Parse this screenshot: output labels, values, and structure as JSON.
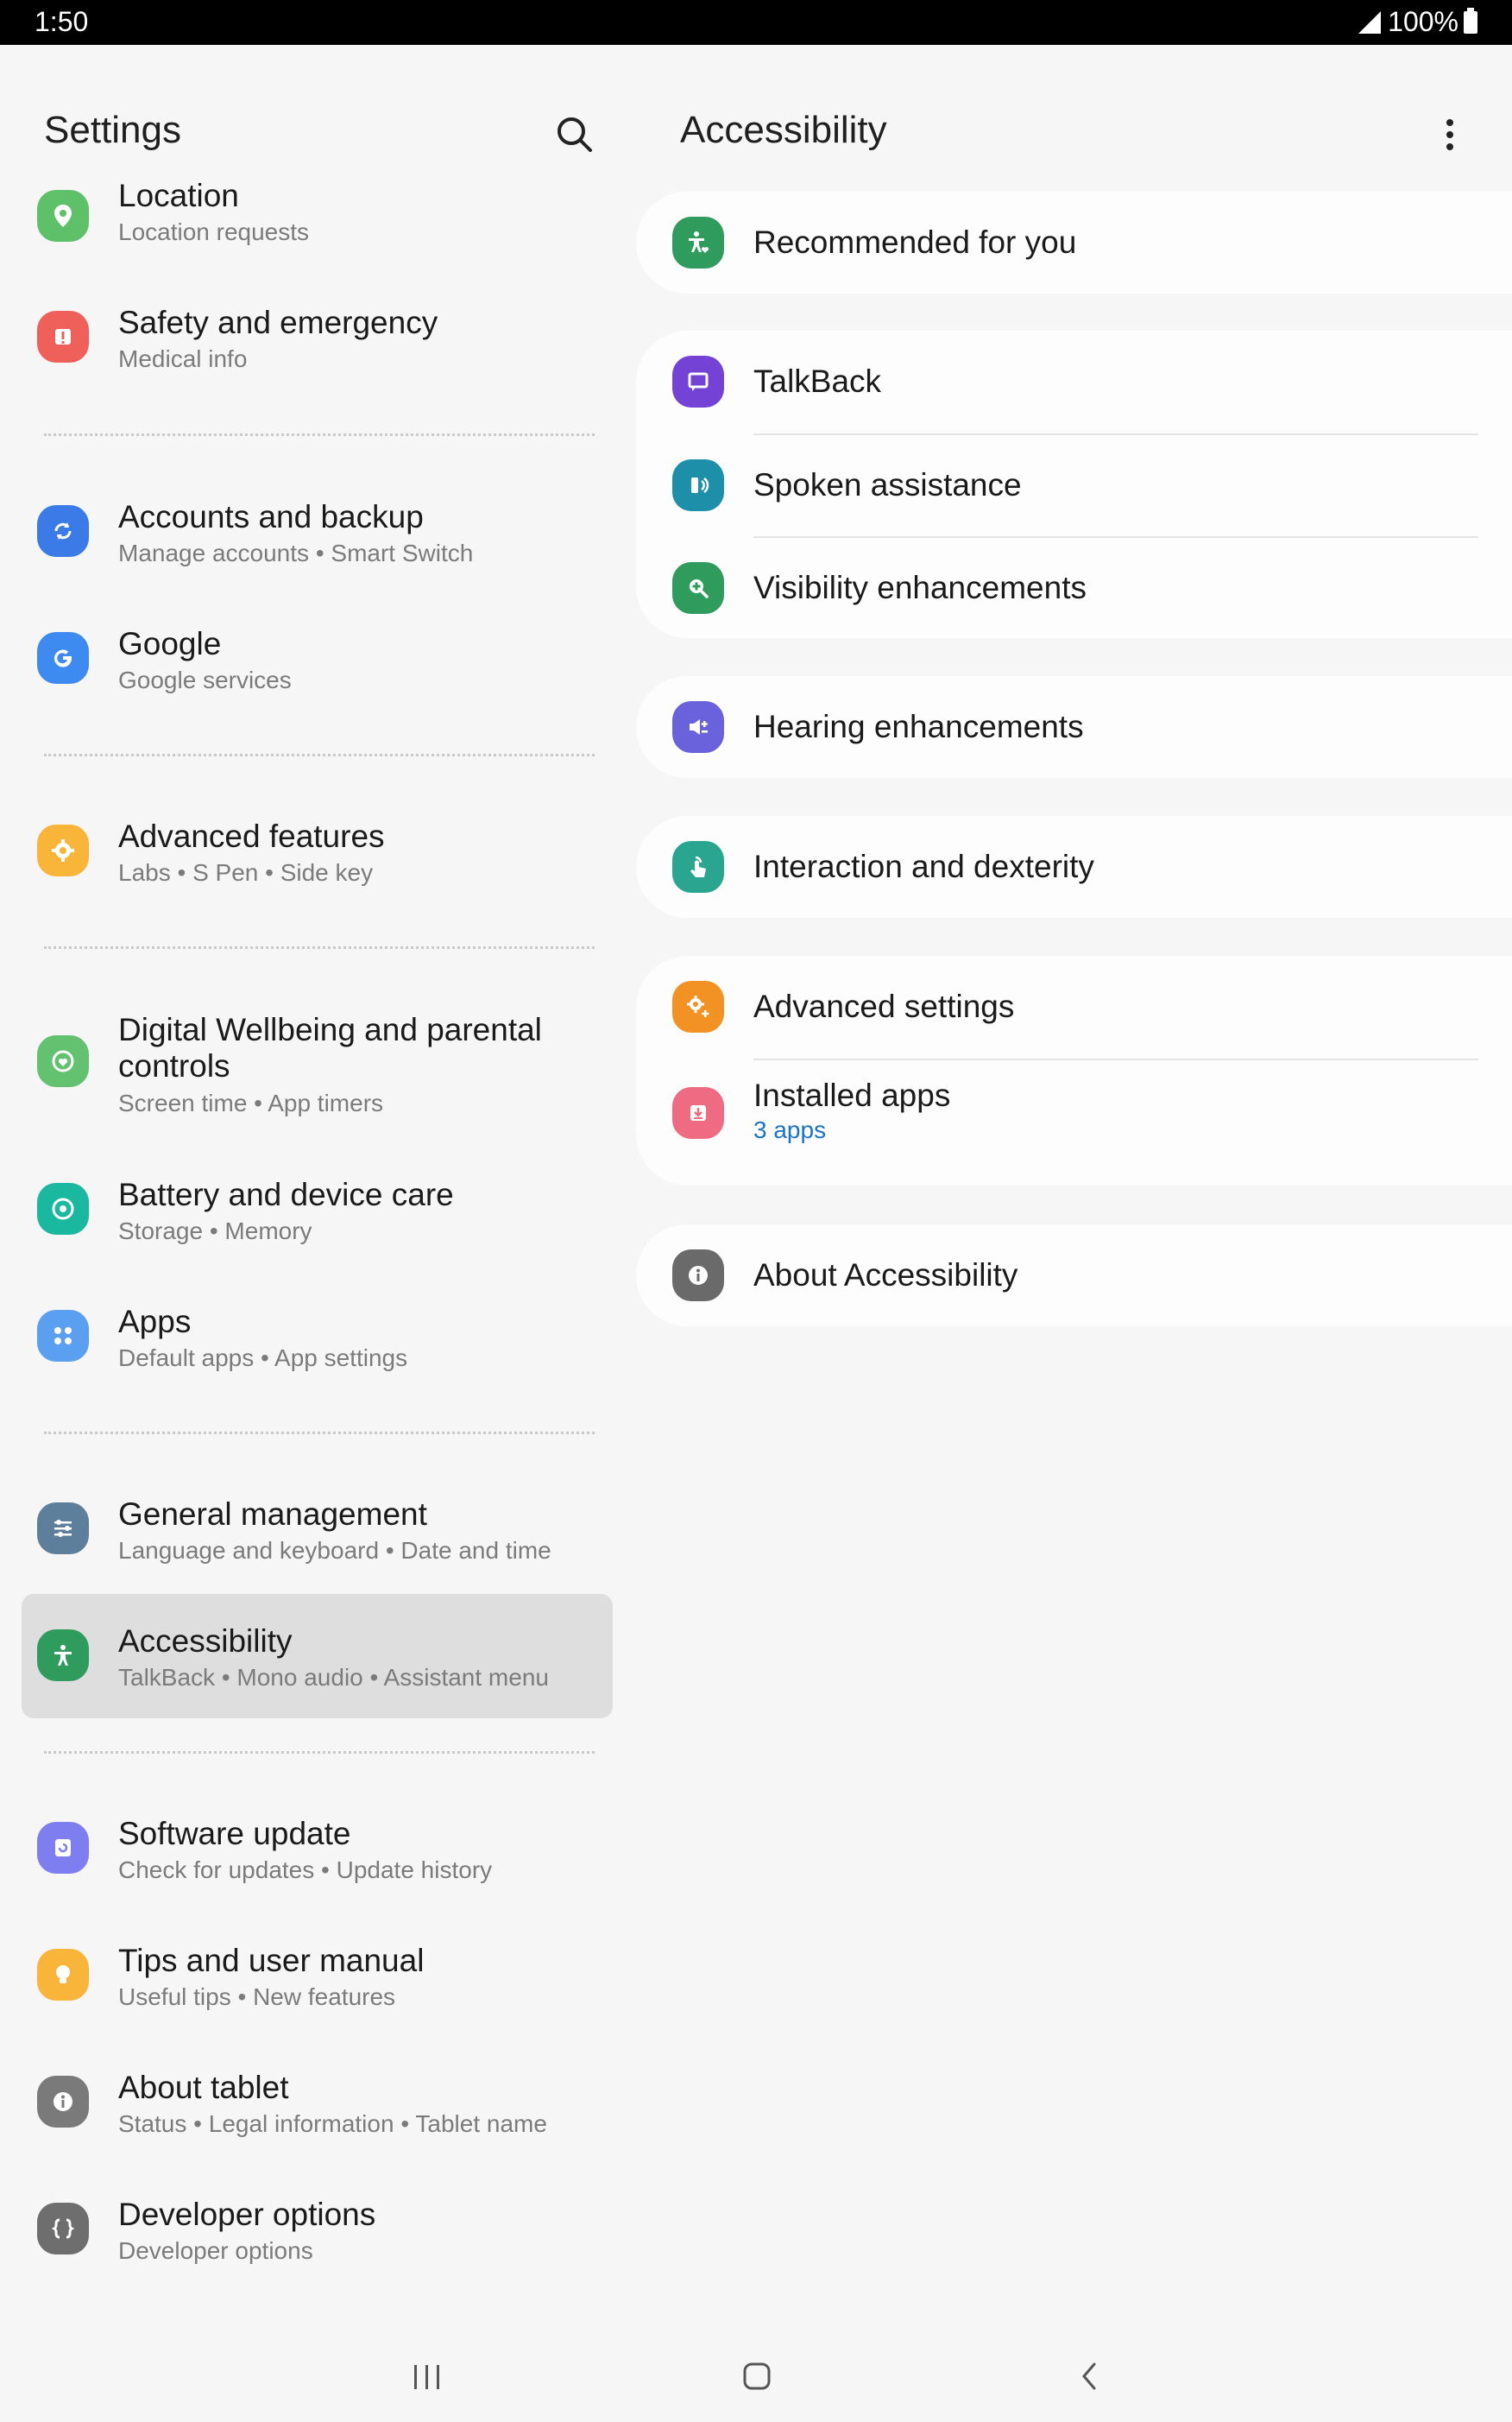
{
  "status_bar": {
    "time": "1:50",
    "battery": "100%"
  },
  "left_panel": {
    "title": "Settings",
    "items": [
      {
        "title": "Location",
        "subtitle": "Location requests",
        "icon": "location-pin-icon",
        "color": "#5fc06a"
      },
      {
        "title": "Safety and emergency",
        "subtitle": "Medical info",
        "icon": "alert-icon",
        "color": "#f0605a"
      },
      {
        "title": "Accounts and backup",
        "subtitle": "Manage accounts  •  Smart Switch",
        "icon": "sync-icon",
        "color": "#3a7be8"
      },
      {
        "title": "Google",
        "subtitle": "Google services",
        "icon": "google-g-icon",
        "color": "#3d8bf0"
      },
      {
        "title": "Advanced features",
        "subtitle": "Labs  •  S Pen  •  Side key",
        "icon": "gear-plus-icon",
        "color": "#f8b53a"
      },
      {
        "title": "Digital Wellbeing and parental",
        "title2": "controls",
        "subtitle": "Screen time  •  App timers",
        "icon": "wellbeing-icon",
        "color": "#62c26f"
      },
      {
        "title": "Battery and device care",
        "subtitle": "Storage  •  Memory",
        "icon": "device-care-icon",
        "color": "#1ab89e"
      },
      {
        "title": "Apps",
        "subtitle": "Default apps  •  App settings",
        "icon": "apps-grid-icon",
        "color": "#5b9ff1"
      },
      {
        "title": "General management",
        "subtitle": "Language and keyboard  •  Date and time",
        "icon": "sliders-icon",
        "color": "#5e7f9b"
      },
      {
        "title": "Accessibility",
        "subtitle": "TalkBack  •  Mono audio  •  Assistant menu",
        "icon": "accessibility-icon",
        "color": "#2f9b5c"
      },
      {
        "title": "Software update",
        "subtitle": "Check for updates  •  Update history",
        "icon": "software-update-icon",
        "color": "#7f7ef0"
      },
      {
        "title": "Tips and user manual",
        "subtitle": "Useful tips  •  New features",
        "icon": "lightbulb-icon",
        "color": "#f8b53a"
      },
      {
        "title": "About tablet",
        "subtitle": "Status  •  Legal information  •  Tablet name",
        "icon": "info-icon",
        "color": "#7a7a7a"
      },
      {
        "title": "Developer options",
        "subtitle": "Developer options",
        "icon": "braces-icon",
        "color": "#6e6e6e"
      }
    ]
  },
  "right_panel": {
    "title": "Accessibility",
    "rows": [
      {
        "title": "Recommended for you",
        "icon": "accessibility-heart-icon",
        "color": "#2f9b5c"
      },
      {
        "title": "TalkBack",
        "icon": "talkback-icon",
        "color": "#7542d6"
      },
      {
        "title": "Spoken assistance",
        "icon": "spoken-assistance-icon",
        "color": "#1d8fa8"
      },
      {
        "title": "Visibility enhancements",
        "icon": "magnify-plus-icon",
        "color": "#2f9b5c"
      },
      {
        "title": "Hearing enhancements",
        "icon": "hearing-icon",
        "color": "#6a62dc"
      },
      {
        "title": "Interaction and dexterity",
        "icon": "touch-icon",
        "color": "#2aa58f"
      },
      {
        "title": "Advanced settings",
        "icon": "gear-plus-icon",
        "color": "#f39224"
      },
      {
        "title": "Installed apps",
        "subtitle": "3 apps",
        "icon": "download-icon",
        "color": "#ee6b82"
      },
      {
        "title": "About Accessibility",
        "icon": "info-icon",
        "color": "#6a6a6a"
      }
    ]
  },
  "nav": {
    "recent": "recents-icon",
    "home": "home-icon",
    "back": "back-icon"
  }
}
